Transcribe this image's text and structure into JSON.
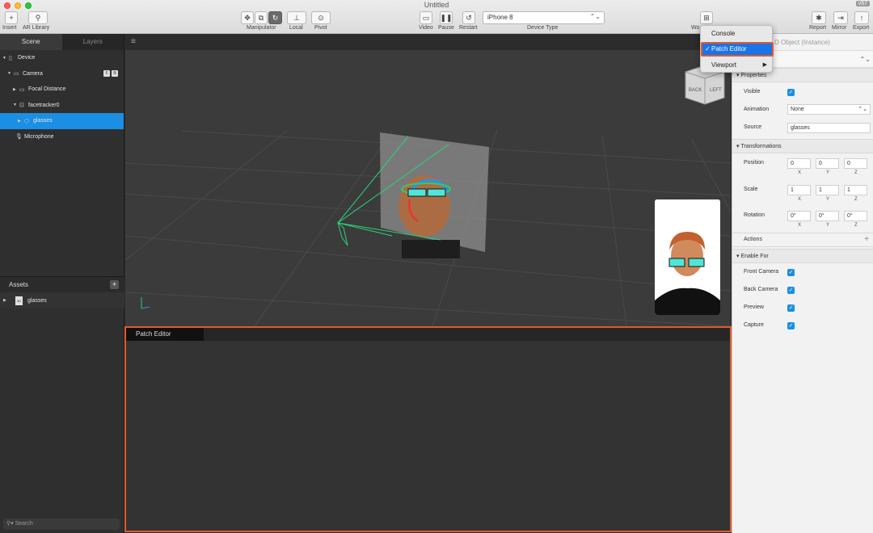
{
  "window": {
    "title": "Untitled",
    "version_badge": "v57"
  },
  "toolbar": {
    "insert_label": "Insert",
    "ar_library_label": "AR Library",
    "manipulator_label": "Manipulator",
    "local_label": "Local",
    "pivot_label": "Pivot",
    "video_label": "Video",
    "pause_label": "Pause",
    "restart_label": "Restart",
    "device_type_label": "Device Type",
    "device_value": "iPhone 8",
    "workspace_label": "Wo",
    "report_label": "Report",
    "mirror_label": "Mirror",
    "export_label": "Export"
  },
  "scene_panel": {
    "tabs": [
      "Scene",
      "Layers"
    ],
    "tree": [
      {
        "label": "Device",
        "icon": "phone-icon"
      },
      {
        "label": "Camera",
        "icon": "camera-icon"
      },
      {
        "label": "Focal Distance",
        "icon": "ruler-icon"
      },
      {
        "label": "facetracker0",
        "icon": "face-tracker-icon"
      },
      {
        "label": "glasses",
        "icon": "cube-icon"
      },
      {
        "label": "Microphone",
        "icon": "microphone-icon"
      }
    ]
  },
  "assets": {
    "title": "Assets",
    "items": [
      {
        "label": "glasses",
        "icon": "file-icon"
      }
    ]
  },
  "search": {
    "placeholder": "Search"
  },
  "viewport": {
    "cube_labels": [
      "BACK",
      "LEFT"
    ]
  },
  "patch_editor": {
    "tab_label": "Patch Editor"
  },
  "workspace_menu": {
    "items": [
      "Console",
      "Patch Editor",
      "Viewport"
    ],
    "checked": "Patch Editor"
  },
  "inspector": {
    "title": "D Object (Instance)",
    "properties_header": "Properties",
    "visible_label": "Visible",
    "animation_label": "Animation",
    "animation_value": "None",
    "source_label": "Source",
    "source_value": "glasses",
    "transformations_header": "Transformations",
    "position_label": "Position",
    "position": [
      "0",
      "0",
      "0"
    ],
    "scale_label": "Scale",
    "scale": [
      "1",
      "1",
      "1"
    ],
    "rotation_label": "Rotation",
    "rotation": [
      "0°",
      "0°",
      "0°"
    ],
    "axes": [
      "X",
      "Y",
      "Z"
    ],
    "actions_label": "Actions",
    "enable_for_header": "Enable For",
    "enable_for": [
      "Front Camera",
      "Back Camera",
      "Preview",
      "Capture"
    ]
  },
  "colors": {
    "accent": "#1a8fe3",
    "highlight_border": "#e05a2b"
  }
}
